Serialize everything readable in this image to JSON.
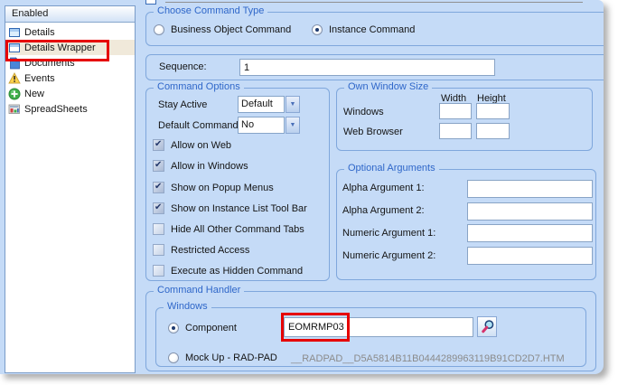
{
  "colors": {
    "annotation": "#e60000",
    "panel": "#c5dbf7",
    "group_title": "#2f67c9"
  },
  "sidebar": {
    "header": "Enabled",
    "items": [
      {
        "label": "Details",
        "icon": "window-icon",
        "selected": false
      },
      {
        "label": "Details Wrapper",
        "icon": "window-icon",
        "selected": true,
        "annotated": true
      },
      {
        "label": "Documents",
        "icon": "document-icon",
        "selected": false
      },
      {
        "label": "Events",
        "icon": "warning-icon",
        "selected": false
      },
      {
        "label": "New",
        "icon": "add-icon",
        "selected": false
      },
      {
        "label": "SpreadSheets",
        "icon": "spreadsheet-icon",
        "selected": false
      }
    ]
  },
  "choose_command_type": {
    "title": "Choose Command Type",
    "options": [
      {
        "label": "Business Object Command",
        "selected": false
      },
      {
        "label": "Instance Command",
        "selected": true
      }
    ]
  },
  "sequence": {
    "label": "Sequence:",
    "value": "1"
  },
  "command_options": {
    "title": "Command Options",
    "stay_active": {
      "label": "Stay Active",
      "value": "Default"
    },
    "default_command": {
      "label": "Default Command",
      "value": "No"
    },
    "checkboxes": [
      {
        "label": "Allow on Web",
        "checked": true
      },
      {
        "label": "Allow in Windows",
        "checked": true
      },
      {
        "label": "Show on Popup Menus",
        "checked": true
      },
      {
        "label": "Show on Instance List Tool Bar",
        "checked": true
      },
      {
        "label": "Hide All Other Command Tabs",
        "checked": false
      },
      {
        "label": "Restricted Access",
        "checked": false
      },
      {
        "label": "Execute as Hidden Command",
        "checked": false
      }
    ]
  },
  "own_window_size": {
    "title": "Own Window Size",
    "col_headers": [
      "Width",
      "Height"
    ],
    "rows": [
      {
        "label": "Windows",
        "width": "",
        "height": ""
      },
      {
        "label": "Web Browser",
        "width": "",
        "height": ""
      }
    ]
  },
  "optional_arguments": {
    "title": "Optional Arguments",
    "fields": [
      {
        "label": "Alpha Argument 1:",
        "value": ""
      },
      {
        "label": "Alpha Argument 2:",
        "value": ""
      },
      {
        "label": "Numeric Argument 1:",
        "value": ""
      },
      {
        "label": "Numeric Argument 2:",
        "value": ""
      }
    ]
  },
  "command_handler": {
    "title": "Command Handler",
    "windows_group": {
      "title": "Windows",
      "component": {
        "label": "Component",
        "selected": true,
        "value": "EOMRMP03",
        "annotated": true
      },
      "mockup": {
        "label": "Mock Up - RAD-PAD",
        "selected": false,
        "file": "__RADPAD__D5A5814B11B0444289963119B91CD2D7.HTM"
      }
    }
  }
}
